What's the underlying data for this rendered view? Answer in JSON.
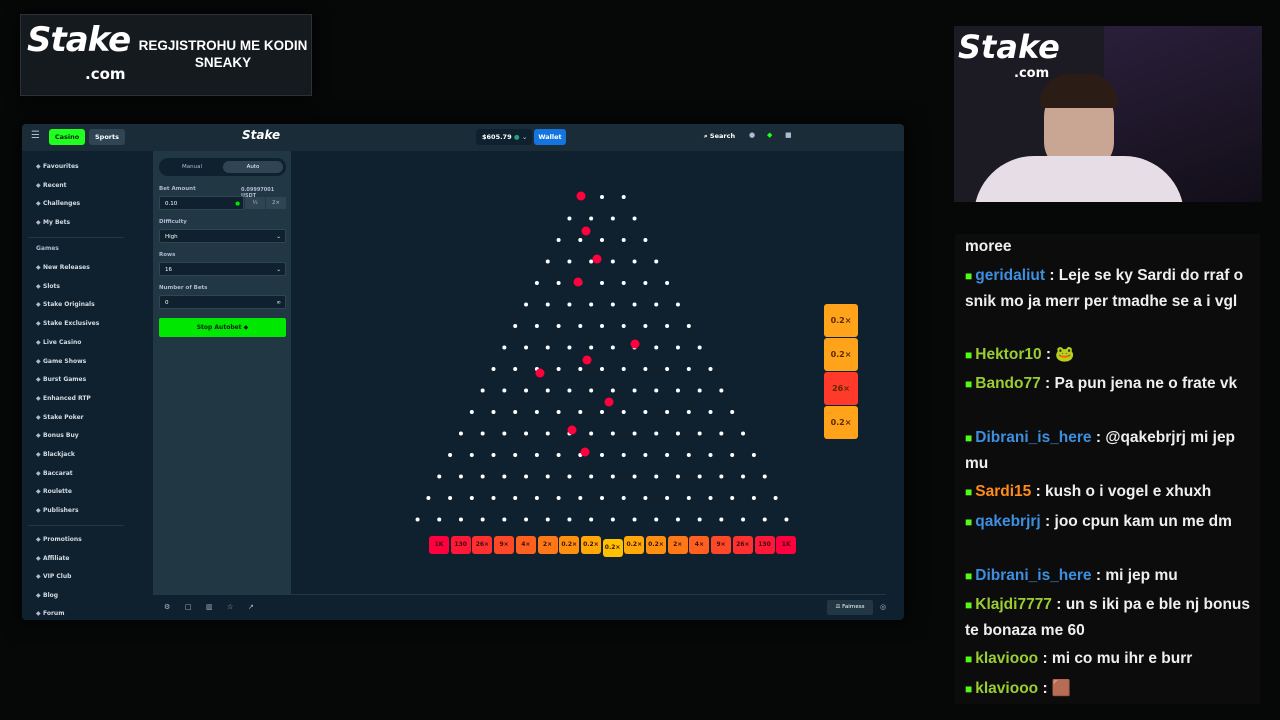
{
  "banner": {
    "brand": "Stake",
    "brand_sub": ".com",
    "promo": "REGJISTROHU ME KODIN SNEAKY"
  },
  "topbar": {
    "casino": "Casino",
    "sports": "Sports",
    "logo": "Stake",
    "balance": "$605.79",
    "wallet": "Wallet",
    "search": "Search"
  },
  "sidebar": {
    "items": [
      "Favourites",
      "Recent",
      "Challenges",
      "My Bets"
    ],
    "section": "Games",
    "games": [
      "New Releases",
      "Slots",
      "Stake Originals",
      "Stake Exclusives",
      "Live Casino",
      "Game Shows",
      "Burst Games",
      "Enhanced RTP",
      "Stake Poker",
      "Bonus Buy",
      "Blackjack",
      "Baccarat",
      "Roulette",
      "Publishers"
    ],
    "bottom": [
      "Promotions",
      "Affiliate",
      "VIP Club",
      "Blog",
      "Forum"
    ]
  },
  "panel": {
    "tab_manual": "Manual",
    "tab_auto": "Auto",
    "bet_amount_label": "Bet Amount",
    "bet_amount_usd": "0.09997001 USDT",
    "bet_value": "0.10",
    "half": "½",
    "double": "2×",
    "difficulty_label": "Difficulty",
    "difficulty_value": "High",
    "rows_label": "Rows",
    "rows_value": "16",
    "num_bets_label": "Number of Bets",
    "num_bets_value": "0",
    "infinity": "∞",
    "stop_button": "Stop Autobet"
  },
  "game": {
    "multipliers": [
      "1K",
      "130",
      "26×",
      "9×",
      "4×",
      "2×",
      "0.2×",
      "0.2×",
      "0.2×",
      "0.2×",
      "0.2×",
      "2×",
      "4×",
      "9×",
      "26×",
      "130",
      "1K"
    ],
    "history": [
      "0.2×",
      "0.2×",
      "26×",
      "0.2×"
    ]
  },
  "footer": {
    "fairness": "Fairness"
  },
  "cam": {
    "brand": "Stake",
    "brand_sub": ".com"
  },
  "chat": [
    {
      "user": "",
      "text": "moree",
      "color": "#ffffff"
    },
    {
      "user": "geridaliut",
      "text": ": Leje se ky Sardi do rraf o snik mo ja merr per tmadhe se a i vgl",
      "color": "#3d8fe0"
    },
    {
      "user": "Hektor10",
      "text": ": 🐸",
      "color": "#9acd32"
    },
    {
      "user": "Bando77",
      "text": ": Pa pun jena ne o frate vk",
      "color": "#9acd32"
    },
    {
      "user": "Dibrani_is_here",
      "text": ": @qakebrjrj mi jep mu",
      "color": "#3d8fe0"
    },
    {
      "user": "Sardi15",
      "text": ": kush o i vogel e xhuxh",
      "color": "#ff8c1a"
    },
    {
      "user": "qakebrjrj",
      "text": ": joo cpun kam un me dm",
      "color": "#3d8fe0"
    },
    {
      "user": "Dibrani_is_here",
      "text": ": mi jep mu",
      "color": "#3d8fe0"
    },
    {
      "user": "Klajdi7777",
      "text": ": un s iki pa e ble nj bonus te bonaza me 60",
      "color": "#9acd32"
    },
    {
      "user": "klaviooo",
      "text": ": mi co mu ihr e burr",
      "color": "#9acd32"
    },
    {
      "user": "klaviooo",
      "text": ": 🟫",
      "color": "#9acd32"
    }
  ],
  "colors": {
    "accent_green": "#00e701",
    "wallet_blue": "#1475e1",
    "bg": "#0f212e"
  }
}
